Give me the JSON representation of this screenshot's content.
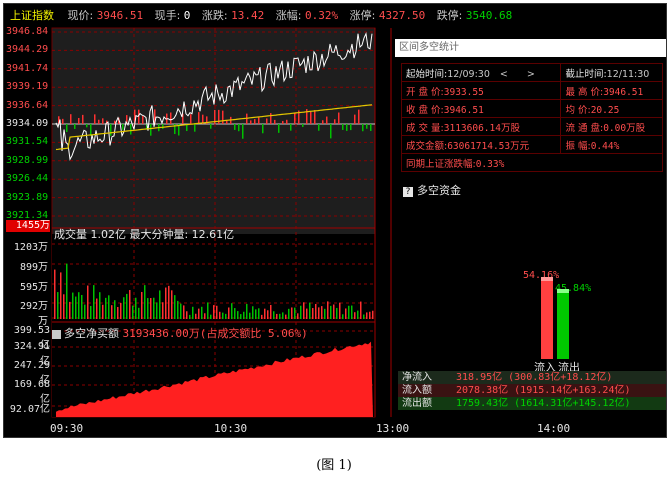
{
  "header": {
    "index_name": "上证指数",
    "price_label": "现价:",
    "price_value": "3946.51",
    "hand_label": "现手:",
    "hand_value": "0",
    "change_label": "涨跌:",
    "change_value": "13.42",
    "pct_label": "涨幅:",
    "pct_value": "0.32%",
    "limit_up_label": "涨停:",
    "limit_up_value": "4327.50",
    "limit_down_label": "跌停:",
    "limit_down_value": "3540.68"
  },
  "price_axis": {
    "ticks": [
      "3946.84",
      "3944.29",
      "3941.74",
      "3939.19",
      "3936.64",
      "3934.09",
      "3931.54",
      "3928.99",
      "3926.44",
      "3923.89",
      "3921.34"
    ],
    "ymin": 3921.34,
    "ymax": 3946.84,
    "base": 3934.09
  },
  "volume_panel": {
    "title": "成交量 1.02亿  最大分钟量: 12.61亿",
    "badge": "1455万",
    "ticks": [
      "1203万",
      "899万",
      "595万",
      "292万",
      "万"
    ]
  },
  "flow_panel": {
    "title": "多空净买额",
    "value_text": "3193436.00万(占成交额比 5.06%)",
    "ticks": [
      "399.53亿",
      "324.91亿",
      "247.29亿",
      "169.68亿",
      "92.07亿"
    ]
  },
  "x_axis": {
    "ticks": [
      "09:30",
      "10:30",
      "13:00",
      "14:00"
    ]
  },
  "stats_panel": {
    "title": "区间多空统计",
    "start_label": "起始时间:",
    "start_value": "12/09:30",
    "end_label": "截止时间:",
    "end_value": "12/11:30",
    "nav_prev": "<",
    "nav_next": ">",
    "rows": [
      {
        "k1": "开 盘 价:",
        "v1": "3933.55",
        "k2": "最 高 价:",
        "v2": "3946.51"
      },
      {
        "k1": "收 盘 价:",
        "v1": "3946.51",
        "k2": "均    价:",
        "v2": "20.25"
      },
      {
        "k1": "成 交 量:",
        "v1": "3113606.14万股",
        "k2": "流 通 盘:",
        "v2": "0.00万股"
      },
      {
        "k1": "成交金额:",
        "v1": "63061714.53万元",
        "k2": "振    幅:",
        "v2": "0.44%"
      }
    ],
    "same_period_label": "同期上证涨跌幅:",
    "same_period_value": "0.33%"
  },
  "funds": {
    "title": "多空资金",
    "inflow_pct": "54.16%",
    "outflow_pct": "45.84%",
    "inflow_share": 54.16,
    "outflow_share": 45.84,
    "inflow_label": "流入",
    "outflow_label": "流出"
  },
  "summary": [
    {
      "label": "净流入",
      "value": "318.95亿 (300.83亿+18.12亿)"
    },
    {
      "label": "流入额",
      "value": "2078.38亿 (1915.14亿+163.24亿)"
    },
    {
      "label": "流出额",
      "value": "1759.43亿 (1614.31亿+145.12亿)"
    }
  ],
  "caption": "(图 1)",
  "colors": {
    "up": "#ff4d4d",
    "down": "#00d200",
    "grid": "#8b0000",
    "price_line": "#ffffff",
    "avg_line": "#e6c800",
    "flow_fill": "#ff2020"
  }
}
